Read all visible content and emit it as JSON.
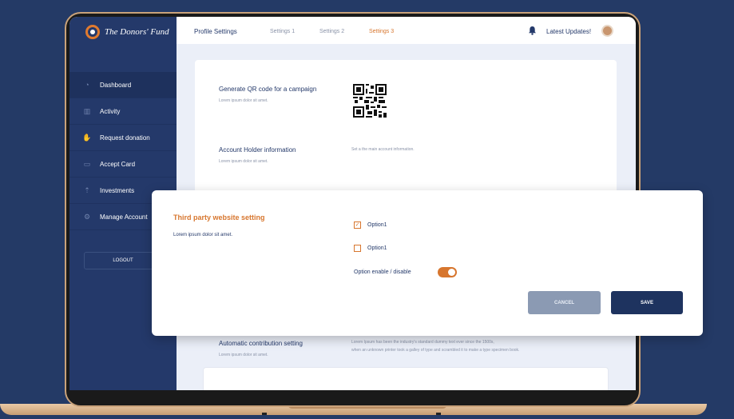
{
  "sidebar": {
    "brand": "The Donors' Fund",
    "items": [
      {
        "label": "Dashboard",
        "icon": "gauge-icon"
      },
      {
        "label": "Activity",
        "icon": "activity-icon"
      },
      {
        "label": "Request donation",
        "icon": "request-icon"
      },
      {
        "label": "Accept Card",
        "icon": "card-icon"
      },
      {
        "label": "Investments",
        "icon": "investments-icon"
      },
      {
        "label": "Manage Account",
        "icon": "gear-icon"
      }
    ],
    "logout": "LOGOUT"
  },
  "topbar": {
    "tabs": [
      "Profile Settings",
      "Settings 1",
      "Settings 2",
      "Settings 3"
    ],
    "active_tab": "Settings 3",
    "latest_updates": "Latest Updates!"
  },
  "main": {
    "rows": [
      {
        "title": "Generate QR code for a campaign",
        "sub": "Lorem ipsum dolor sit amet."
      },
      {
        "title": "Account Holder information",
        "sub": "Lorem ipsum dolor sit amet.",
        "desc": "Set a the main account information."
      },
      {
        "title": "Automatic contribution setting",
        "sub": "Lorem ipsum dolor sit amet.",
        "desc1": "Lorem Ipsum has been the industry's standard dummy text ever since the 1500s,",
        "desc2": "when an unknown printer took a galley of type and scrambled it to make a type specimen book."
      }
    ]
  },
  "modal": {
    "title": "Third party website setting",
    "subtitle": "Lorem ipsum dolor sit amet.",
    "options": [
      {
        "label": "Option1",
        "checked": true
      },
      {
        "label": "Option1",
        "checked": false
      }
    ],
    "toggle_label": "Option enable / disable",
    "toggle_on": true,
    "cancel_label": "CANCEL",
    "save_label": "SAVE"
  },
  "colors": {
    "navy": "#24396a",
    "accent": "#d7762e",
    "background": "#243a66"
  }
}
